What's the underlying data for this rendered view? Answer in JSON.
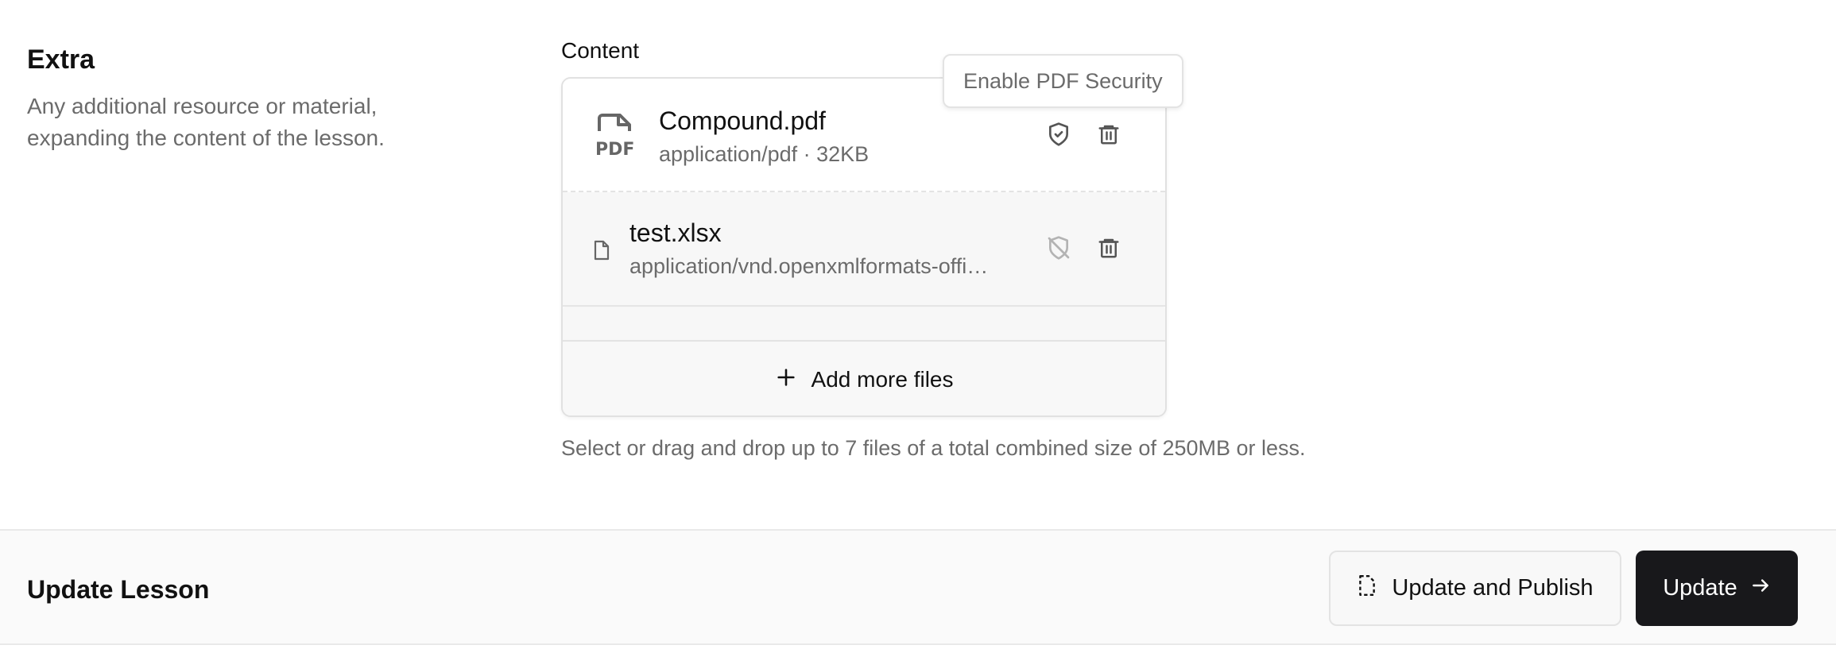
{
  "extra": {
    "title": "Extra",
    "description": "Any additional resource or material, expanding the content of the lesson."
  },
  "content": {
    "label": "Content",
    "files": [
      {
        "name": "Compound.pdf",
        "meta": "application/pdf · 32KB",
        "icon": "pdf-file-icon",
        "security": "enabled"
      },
      {
        "name": "test.xlsx",
        "meta": "application/vnd.openxmlformats-offi…",
        "icon": "file-icon",
        "security": "disabled"
      }
    ],
    "add_more_label": "Add more files",
    "tooltip": "Enable PDF Security",
    "hint": "Select or drag and drop up to 7 files of a total combined size of 250MB or less."
  },
  "footer": {
    "title": "Update Lesson",
    "publish_label": "Update and Publish",
    "update_label": "Update"
  },
  "colors": {
    "primary_button": "#18181b",
    "muted_text": "#6b6b6b",
    "border": "#e3e3e3"
  }
}
